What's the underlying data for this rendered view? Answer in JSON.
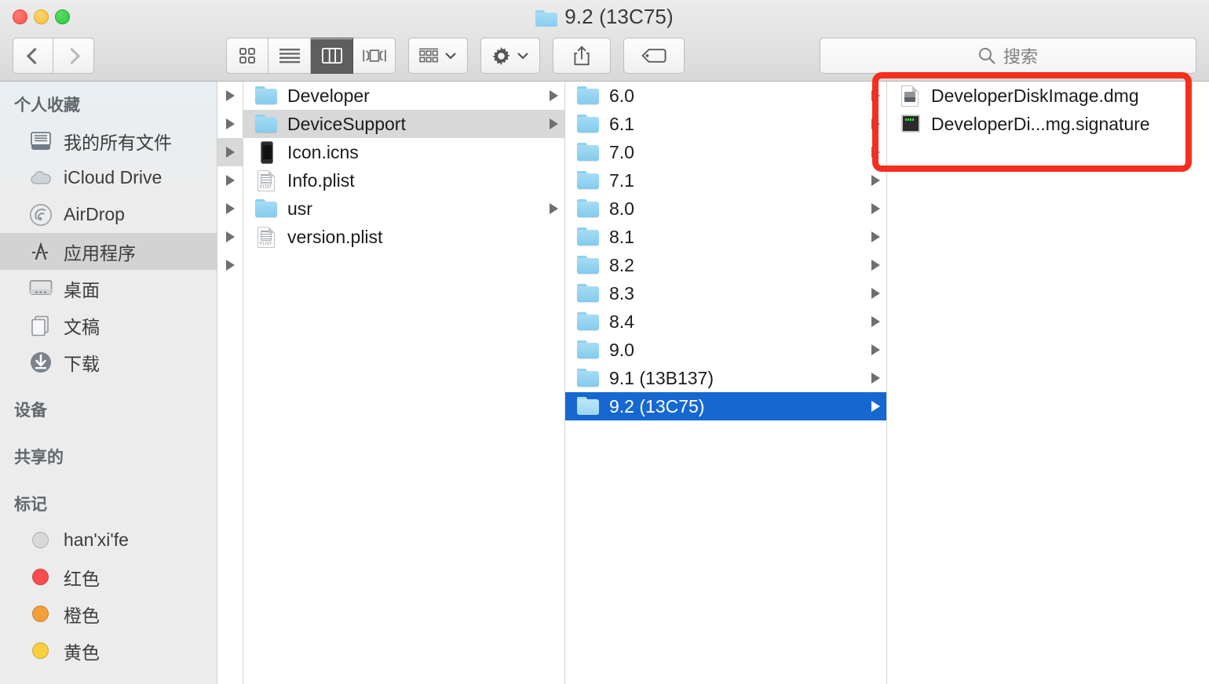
{
  "window": {
    "title": "9.2 (13C75)",
    "title_icon": "folder-icon",
    "traffic_lights": [
      {
        "name": "close-button",
        "color": "#f9554b"
      },
      {
        "name": "minimize-button",
        "color": "#f9bc3f"
      },
      {
        "name": "zoom-button",
        "color": "#27c93f"
      }
    ]
  },
  "toolbar": {
    "back_label": "chevron-left-icon",
    "forward_label": "chevron-right-icon",
    "view_modes": [
      {
        "name": "icon-view",
        "label": "icon-grid-icon",
        "active": false
      },
      {
        "name": "list-view",
        "label": "list-lines-icon",
        "active": false
      },
      {
        "name": "column-view",
        "label": "columns-icon",
        "active": true
      },
      {
        "name": "coverflow-view",
        "label": "coverflow-icon",
        "active": false
      }
    ],
    "arrange_label": "arrange-grid-icon",
    "action_label": "gear-icon",
    "share_label": "share-icon",
    "tag_label": "tag-icon"
  },
  "search": {
    "placeholder": "搜索",
    "value": "",
    "icon": "search-icon"
  },
  "sidebar": {
    "sections": [
      {
        "header": "个人收藏",
        "items": [
          {
            "label": "我的所有文件",
            "icon": "all-files-icon",
            "selected": false
          },
          {
            "label": "iCloud Drive",
            "icon": "cloud-icon",
            "selected": false
          },
          {
            "label": "AirDrop",
            "icon": "airdrop-icon",
            "selected": false
          },
          {
            "label": "应用程序",
            "icon": "applications-icon",
            "selected": true
          },
          {
            "label": "桌面",
            "icon": "desktop-icon",
            "selected": false
          },
          {
            "label": "文稿",
            "icon": "documents-icon",
            "selected": false
          },
          {
            "label": "下载",
            "icon": "downloads-icon",
            "selected": false
          }
        ]
      },
      {
        "header": "设备",
        "items": []
      },
      {
        "header": "共享的",
        "items": []
      },
      {
        "header": "标记",
        "items": [
          {
            "label": "han'xi'fe",
            "icon": "tag-dot",
            "color": "#d8d8d8",
            "selected": false
          },
          {
            "label": "红色",
            "icon": "tag-dot",
            "color": "#fb4d4d",
            "selected": false
          },
          {
            "label": "橙色",
            "icon": "tag-dot",
            "color": "#f3a03a",
            "selected": false
          },
          {
            "label": "黄色",
            "icon": "tag-dot",
            "color": "#f7cf3f",
            "selected": false
          }
        ]
      }
    ]
  },
  "browser": {
    "stub_column": {
      "rows": [
        {
          "has_arrow": true,
          "selected": false
        },
        {
          "has_arrow": true,
          "selected": false
        },
        {
          "has_arrow": true,
          "selected": true
        },
        {
          "has_arrow": true,
          "selected": false
        },
        {
          "has_arrow": true,
          "selected": false
        },
        {
          "has_arrow": true,
          "selected": false
        },
        {
          "has_arrow": true,
          "selected": false
        }
      ]
    },
    "columns": [
      {
        "name": "column-1",
        "rows": [
          {
            "label": "Developer",
            "icon": "folder-icon",
            "has_arrow": true,
            "selected": false
          },
          {
            "label": "DeviceSupport",
            "icon": "folder-icon",
            "has_arrow": true,
            "selected": "gray"
          },
          {
            "label": "Icon.icns",
            "icon": "device-icon",
            "has_arrow": false,
            "selected": false
          },
          {
            "label": "Info.plist",
            "icon": "plist-icon",
            "has_arrow": false,
            "selected": false
          },
          {
            "label": "usr",
            "icon": "folder-icon",
            "has_arrow": true,
            "selected": false
          },
          {
            "label": "version.plist",
            "icon": "plist-icon",
            "has_arrow": false,
            "selected": false
          }
        ]
      },
      {
        "name": "column-2",
        "rows": [
          {
            "label": "6.0",
            "icon": "folder-icon",
            "has_arrow": true,
            "selected": false
          },
          {
            "label": "6.1",
            "icon": "folder-icon",
            "has_arrow": true,
            "selected": false
          },
          {
            "label": "7.0",
            "icon": "folder-icon",
            "has_arrow": true,
            "selected": false
          },
          {
            "label": "7.1",
            "icon": "folder-icon",
            "has_arrow": true,
            "selected": false
          },
          {
            "label": "8.0",
            "icon": "folder-icon",
            "has_arrow": true,
            "selected": false
          },
          {
            "label": "8.1",
            "icon": "folder-icon",
            "has_arrow": true,
            "selected": false
          },
          {
            "label": "8.2",
            "icon": "folder-icon",
            "has_arrow": true,
            "selected": false
          },
          {
            "label": "8.3",
            "icon": "folder-icon",
            "has_arrow": true,
            "selected": false
          },
          {
            "label": "8.4",
            "icon": "folder-icon",
            "has_arrow": true,
            "selected": false
          },
          {
            "label": "9.0",
            "icon": "folder-icon",
            "has_arrow": true,
            "selected": false
          },
          {
            "label": "9.1 (13B137)",
            "icon": "folder-icon",
            "has_arrow": true,
            "selected": false
          },
          {
            "label": "9.2 (13C75)",
            "icon": "folder-icon",
            "has_arrow": true,
            "selected": "blue"
          }
        ]
      },
      {
        "name": "column-3",
        "rows": [
          {
            "label": "DeveloperDiskImage.dmg",
            "icon": "dmg-icon",
            "has_arrow": false,
            "selected": false
          },
          {
            "label": "DeveloperDi...mg.signature",
            "icon": "signature-icon",
            "has_arrow": false,
            "selected": false
          }
        ]
      }
    ]
  },
  "annotation": {
    "name": "red-highlight-box",
    "color": "#f52e1e"
  }
}
